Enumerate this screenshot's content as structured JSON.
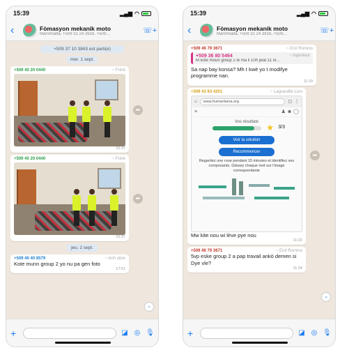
{
  "left": {
    "status_time": "15:39",
    "chat_title": "Fòmasyon mekanik moto",
    "chat_subtitle": "Marshnalta, +509 31 24 3916, +509…",
    "messages": {
      "top_note": "+509 37 10 3843 est parti(e)",
      "date1": "mer. 1 sept.",
      "photo1_sender": "+509 40 20 0440",
      "photo1_alias": "~ Frèrè",
      "photo1_time": "10:37",
      "photo2_sender": "+509 40 20 0440",
      "photo2_alias": "~ Frèrè",
      "photo2_time": "10:37",
      "date2": "jeu. 2 sept.",
      "msg_sender": "+509 40 40 8579",
      "msg_alias": "~ Anh stive",
      "msg_text": "Kote munn group 2 yo nu pa gen foto",
      "msg_time": "17:51"
    }
  },
  "right": {
    "status_time": "15:39",
    "chat_title": "Fòmasyon mekanik moto",
    "chat_subtitle": "Marshnalta, +509 31 24 3916, +509…",
    "msg1": {
      "sender": "+509 46 79 3671",
      "alias": "~ Erol Romino",
      "quoted_name": "+509 36 80 5464",
      "quoted_alias": "~ Ingenieur",
      "quoted_text": "M kote moun group 2 le ma li 10h jwal 11 ol…",
      "text": "Sa nap bay konsa? Mh t kwè yo t modifye programme nan.",
      "time": "11:20"
    },
    "msg2": {
      "sender": "+509 43 93 4201",
      "alias": "~ Lagrandile Lion",
      "url": "www.humanlama.org",
      "results_label": "Vos résultats",
      "score": "3/3",
      "progress_fraction": 0.85,
      "btn1": "Voir la solution",
      "btn2": "Recommencer",
      "instructions": "Regardez une roue pendant 15 minutes et identifiez ses composants. Glissez chaque mot sur l'image correspondante",
      "caption": "Mw kite nou wi lève pye nou",
      "time": "11:22"
    },
    "msg3": {
      "sender": "+509 46 79 3671",
      "alias": "~ Erol Romino",
      "text": "5vp eske group 2 a pap travail ankò demen si Dye vle?",
      "time": "11:24"
    }
  }
}
